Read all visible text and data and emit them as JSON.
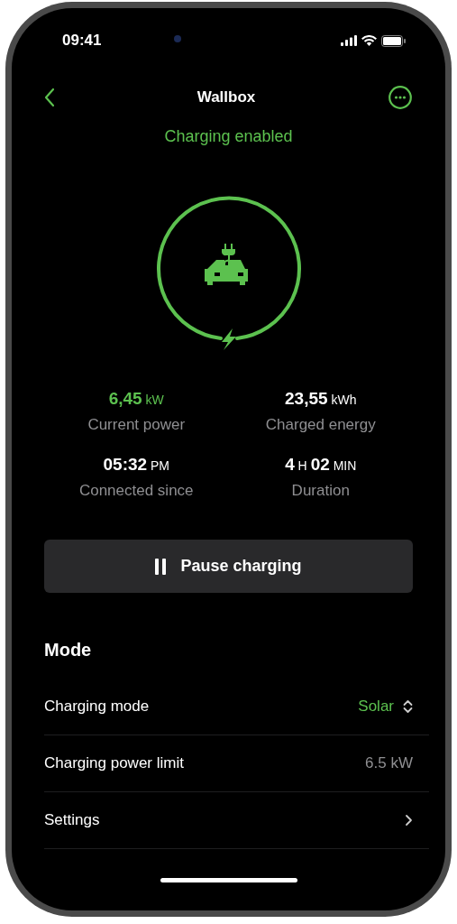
{
  "status_bar": {
    "time": "09:41"
  },
  "nav": {
    "title": "Wallbox"
  },
  "status": "Charging enabled",
  "stats": [
    {
      "value": "**6,45** kW",
      "label": "Current power",
      "highlighted": true
    },
    {
      "value": "**23,55** kWh",
      "label": "Charged energy",
      "highlighted": false
    },
    {
      "value": "**05:32** PM",
      "label": "Connected since",
      "highlighted": false
    },
    {
      "value": "**4** H **02** MIN",
      "label": "Duration",
      "highlighted": false
    }
  ],
  "pause_button": {
    "label": "Pause charging"
  },
  "section_title": "Mode",
  "rows": [
    {
      "label": "Charging mode",
      "value": "Solar",
      "kind": "picker"
    },
    {
      "label": "Charging power limit",
      "value": "6.5 kW",
      "kind": "value"
    },
    {
      "label": "Settings",
      "kind": "link"
    }
  ]
}
